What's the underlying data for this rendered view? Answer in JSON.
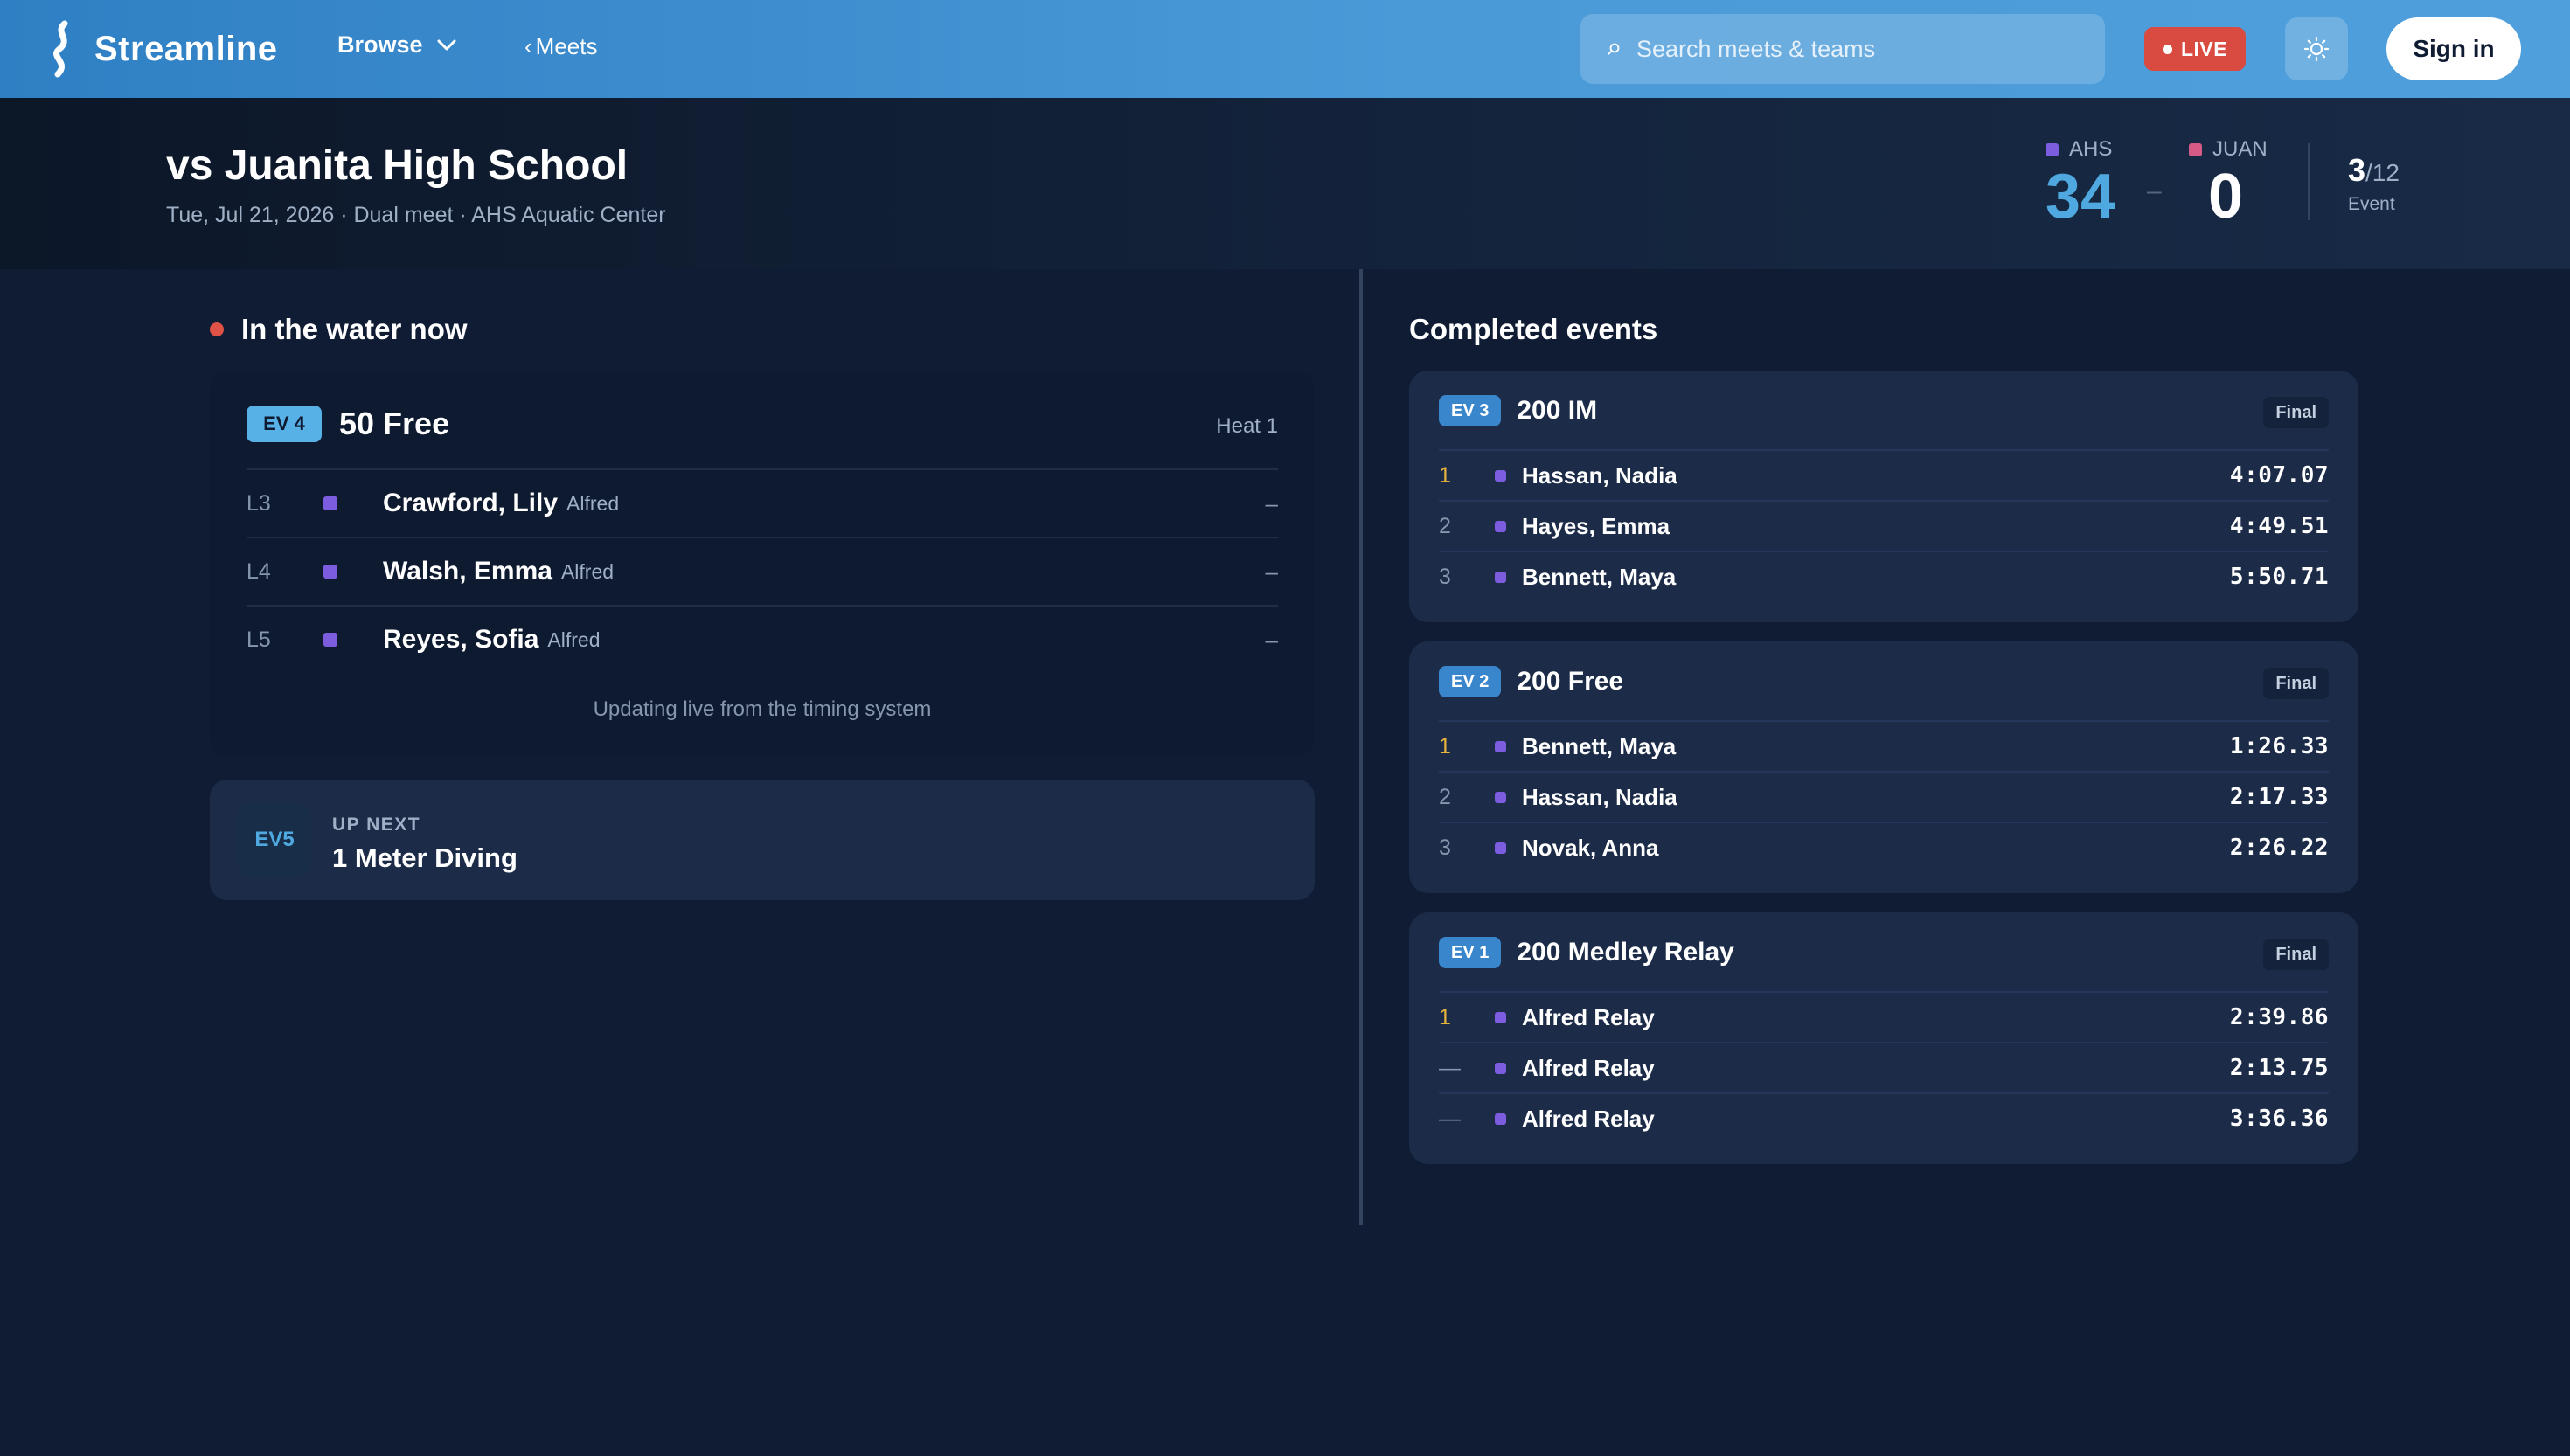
{
  "nav": {
    "brand": "Streamline",
    "browse_label": "Browse",
    "meets_label": "Meets",
    "search_placeholder": "Search meets & teams",
    "live_label": "LIVE",
    "signin_label": "Sign in"
  },
  "meet": {
    "title": "vs Juanita High School",
    "subtitle": "Tue, Jul 21, 2026 · Dual meet · AHS Aquatic Center",
    "home": {
      "abbr": "AHS",
      "score": "34",
      "color": "#7c5de0"
    },
    "away": {
      "abbr": "JUAN",
      "score": "0",
      "color": "#d65a86"
    },
    "score_sep": "–",
    "event_current": "3",
    "event_total": "/12",
    "event_label": "Event"
  },
  "live": {
    "section_title": "In the water now",
    "event_badge": "EV 4",
    "event_name": "50 Free",
    "heat": "Heat 1",
    "lanes": [
      {
        "lane": "L3",
        "name": "Crawford, Lily",
        "team": "Alfred",
        "time": "–"
      },
      {
        "lane": "L4",
        "name": "Walsh, Emma",
        "team": "Alfred",
        "time": "–"
      },
      {
        "lane": "L5",
        "name": "Reyes, Sofia",
        "team": "Alfred",
        "time": "–"
      }
    ],
    "footer": "Updating live from the timing system"
  },
  "next": {
    "badge": "EV5",
    "label": "UP NEXT",
    "name": "1 Meter Diving"
  },
  "completed": {
    "section_title": "Completed events",
    "events": [
      {
        "badge": "EV 3",
        "name": "200 IM",
        "status": "Final",
        "results": [
          {
            "place": "1",
            "name": "Hassan, Nadia",
            "time": "4:07.07"
          },
          {
            "place": "2",
            "name": "Hayes, Emma",
            "time": "4:49.51"
          },
          {
            "place": "3",
            "name": "Bennett, Maya",
            "time": "5:50.71"
          }
        ]
      },
      {
        "badge": "EV 2",
        "name": "200 Free",
        "status": "Final",
        "results": [
          {
            "place": "1",
            "name": "Bennett, Maya",
            "time": "1:26.33"
          },
          {
            "place": "2",
            "name": "Hassan, Nadia",
            "time": "2:17.33"
          },
          {
            "place": "3",
            "name": "Novak, Anna",
            "time": "2:26.22"
          }
        ]
      },
      {
        "badge": "EV 1",
        "name": "200 Medley Relay",
        "status": "Final",
        "results": [
          {
            "place": "1",
            "name": "Alfred Relay",
            "time": "2:39.86"
          },
          {
            "place": "—",
            "name": "Alfred Relay",
            "time": "2:13.75"
          },
          {
            "place": "—",
            "name": "Alfred Relay",
            "time": "3:36.36"
          }
        ]
      }
    ]
  }
}
